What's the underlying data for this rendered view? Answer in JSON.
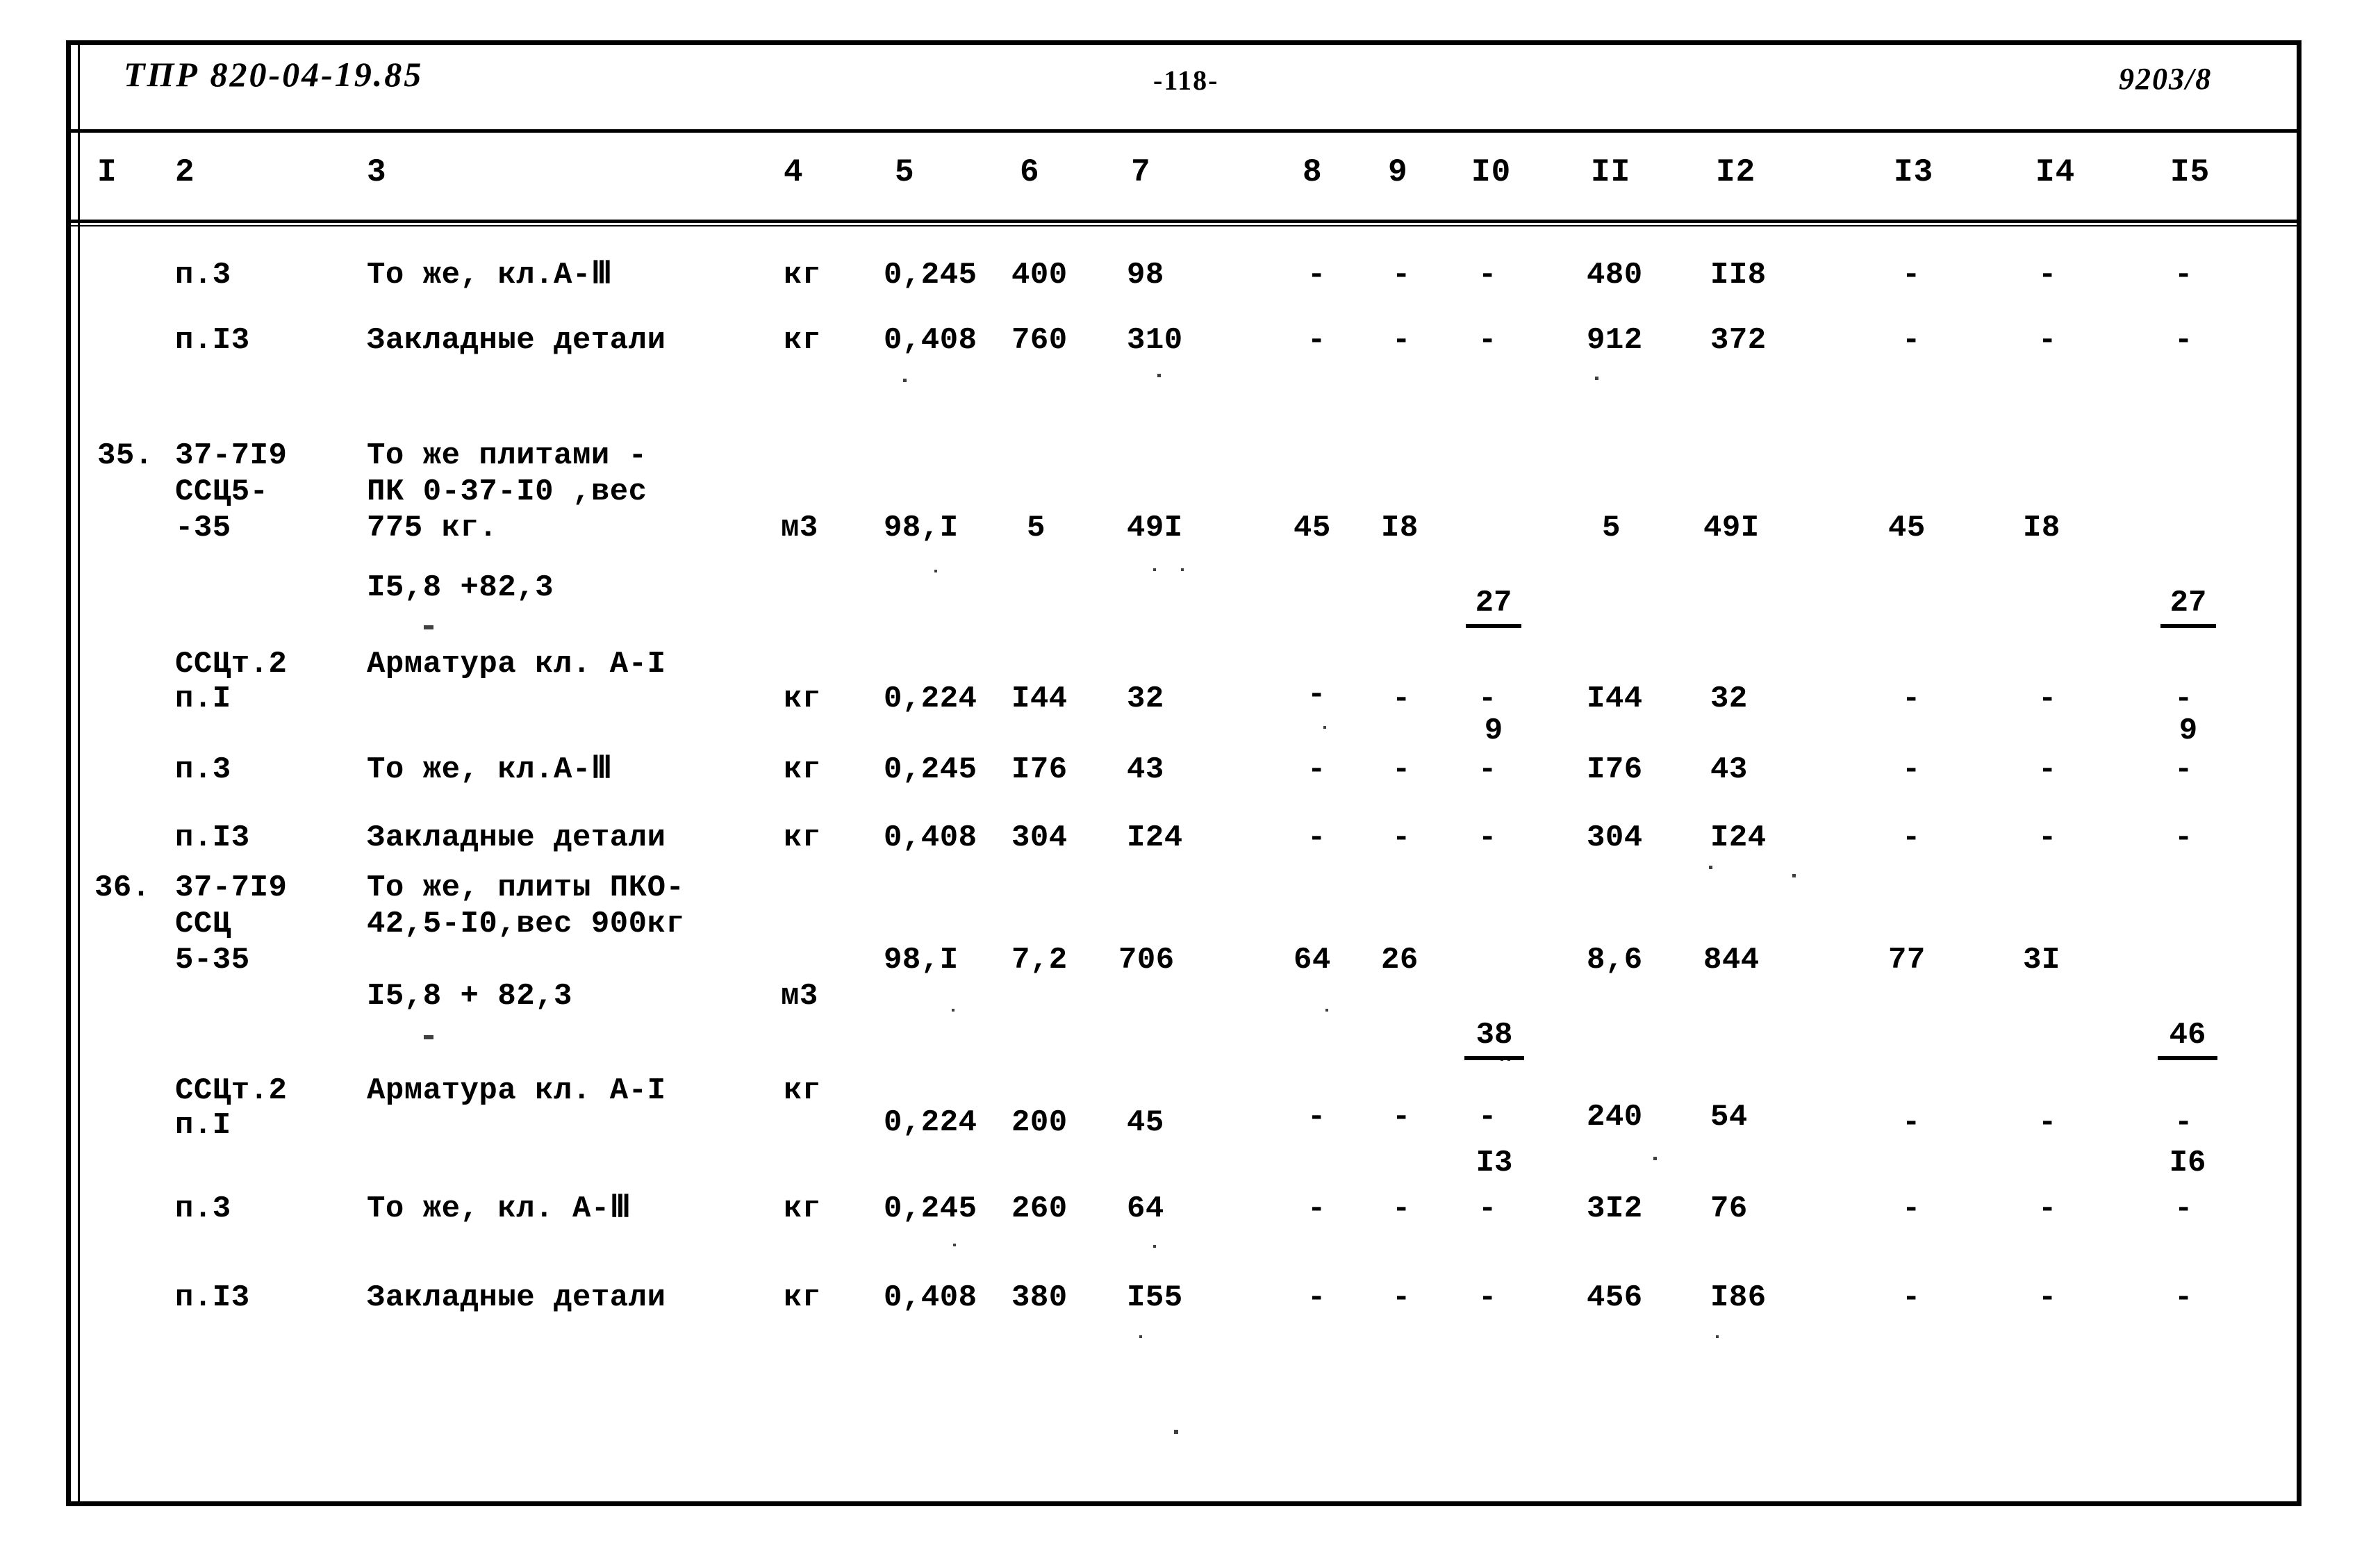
{
  "header": {
    "doc_code": "ТПР 820-04-19.85",
    "page_number": "-118-",
    "sheet_code": "9203/8"
  },
  "table": {
    "column_numbers": [
      "I",
      "2",
      "3",
      "4",
      "5",
      "6",
      "7",
      "8",
      "9",
      "I0",
      "II",
      "I2",
      "I3",
      "I4",
      "I5"
    ],
    "rows": [
      {
        "no": "",
        "code": "п.3",
        "name": "То же, кл.А-Ⅲ",
        "unit": "кг",
        "c5": "0,245",
        "c6": "400",
        "c7": "98",
        "c8": "-",
        "c9": "-",
        "c10": "-",
        "c11": "480",
        "c12": "II8",
        "c13": "-",
        "c14": "-",
        "c15": "-"
      },
      {
        "no": "",
        "code": "п.I3",
        "name": "Закладные детали",
        "unit": "кг",
        "c5": "0,408",
        "c6": "760",
        "c7": "310",
        "c8": "-",
        "c9": "-",
        "c10": "-",
        "c11": "912",
        "c12": "372",
        "c13": "-",
        "c14": "-",
        "c15": "-"
      },
      {
        "no": "35.",
        "code_line1": "37-7I9",
        "code_line2": "ССЦ5-",
        "code_line3": "-35",
        "name_line1": "То же плитами -",
        "name_line2": "ПК 0-37-I0 ,вес",
        "name_line3": "775 кг.",
        "name_line4": "I5,8 +82,3",
        "unit": "м3",
        "c5": "98,I",
        "c6": "5",
        "c7": "49I",
        "c8": "45",
        "c9": "I8",
        "c10_top": "27",
        "c10_bot": "9",
        "c11": "5",
        "c12": "49I",
        "c13": "45",
        "c14": "I8",
        "c15_top": "27",
        "c15_bot": "9"
      },
      {
        "no": "",
        "code_line1": "ССЦт.2",
        "code_line2": "п.I",
        "name": "Арматура кл. А-I",
        "unit": "кг",
        "c5": "0,224",
        "c6": "I44",
        "c7": "32",
        "c8": "-",
        "c9": "-",
        "c10": "-",
        "c11": "I44",
        "c12": "32",
        "c13": "-",
        "c14": "-",
        "c15": "-"
      },
      {
        "no": "",
        "code": "п.3",
        "name": "То же, кл.А-Ⅲ",
        "unit": "кг",
        "c5": "0,245",
        "c6": "I76",
        "c7": "43",
        "c8": "-",
        "c9": "-",
        "c10": "-",
        "c11": "I76",
        "c12": "43",
        "c13": "-",
        "c14": "-",
        "c15": "-"
      },
      {
        "no": "",
        "code": "п.I3",
        "name": "Закладные детали",
        "unit": "кг",
        "c5": "0,408",
        "c6": "304",
        "c7": "I24",
        "c8": "-",
        "c9": "-",
        "c10": "-",
        "c11": "304",
        "c12": "I24",
        "c13": "-",
        "c14": "-",
        "c15": "-"
      },
      {
        "no": "36.",
        "code_line1": "37-7I9",
        "code_line2": "ССЦ",
        "code_line3": "5-35",
        "name_line1": "То же, плиты ПКО-",
        "name_line2": "42,5-I0,вес 900кг",
        "name_line3": "I5,8 + 82,3",
        "unit": "м3",
        "c5": "98,I",
        "c6": "7,2",
        "c7": "706",
        "c8": "64",
        "c9": "26",
        "c10_top": "38",
        "c10_bot": "I3",
        "c11": "8,6",
        "c12": "844",
        "c13": "77",
        "c14": "3I",
        "c15_top": "46",
        "c15_bot": "I6"
      },
      {
        "no": "",
        "code_line1": "ССЦт.2",
        "code_line2": "п.I",
        "name": "Арматура кл. А-I",
        "unit": "кг",
        "c5": "0,224",
        "c6": "200",
        "c7": "45",
        "c8": "-",
        "c9": "-",
        "c10": "-",
        "c11": "240",
        "c12": "54",
        "c13": "-",
        "c14": "-",
        "c15": "-"
      },
      {
        "no": "",
        "code": "п.3",
        "name": "То же, кл. А-Ⅲ",
        "unit": "кг",
        "c5": "0,245",
        "c6": "260",
        "c7": "64",
        "c8": "-",
        "c9": "-",
        "c10": "-",
        "c11": "3I2",
        "c12": "76",
        "c13": "-",
        "c14": "-",
        "c15": "-"
      },
      {
        "no": "",
        "code": "п.I3",
        "name": "Закладные детали",
        "unit": "кг",
        "c5": "0,408",
        "c6": "380",
        "c7": "I55",
        "c8": "-",
        "c9": "-",
        "c10": "-",
        "c11": "456",
        "c12": "I86",
        "c13": "-",
        "c14": "-",
        "c15": "-"
      }
    ]
  }
}
